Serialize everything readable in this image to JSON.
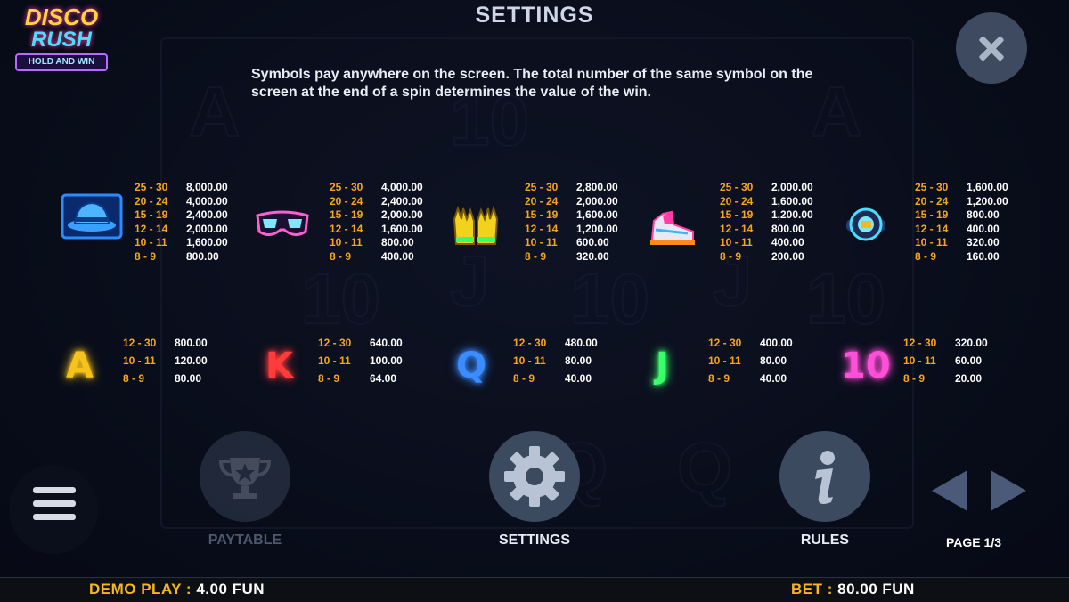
{
  "logo": {
    "line1": "DISCO",
    "line2": "RUSH",
    "badge": "HOLD AND WIN"
  },
  "header": {
    "title": "SETTINGS"
  },
  "description": "Symbols pay anywhere on the screen. The total number of the same symbol on the screen at the end of a spin determines the value of the win.",
  "high_symbols": [
    {
      "icon": "hat-icon",
      "pays": [
        [
          "25 - 30",
          "8,000.00"
        ],
        [
          "20 - 24",
          "4,000.00"
        ],
        [
          "15 - 19",
          "2,400.00"
        ],
        [
          "12 - 14",
          "2,000.00"
        ],
        [
          "10 - 11",
          "1,600.00"
        ],
        [
          "8 - 9",
          "800.00"
        ]
      ]
    },
    {
      "icon": "sunglasses-icon",
      "pays": [
        [
          "25 - 30",
          "4,000.00"
        ],
        [
          "20 - 24",
          "2,400.00"
        ],
        [
          "15 - 19",
          "2,000.00"
        ],
        [
          "12 - 14",
          "1,600.00"
        ],
        [
          "10 - 11",
          "800.00"
        ],
        [
          "8 - 9",
          "400.00"
        ]
      ]
    },
    {
      "icon": "gloves-icon",
      "pays": [
        [
          "25 - 30",
          "2,800.00"
        ],
        [
          "20 - 24",
          "2,000.00"
        ],
        [
          "15 - 19",
          "1,600.00"
        ],
        [
          "12 - 14",
          "1,200.00"
        ],
        [
          "10 - 11",
          "600.00"
        ],
        [
          "8 - 9",
          "320.00"
        ]
      ]
    },
    {
      "icon": "sneaker-icon",
      "pays": [
        [
          "25 - 30",
          "2,000.00"
        ],
        [
          "20 - 24",
          "1,600.00"
        ],
        [
          "15 - 19",
          "1,200.00"
        ],
        [
          "12 - 14",
          "800.00"
        ],
        [
          "10 - 11",
          "400.00"
        ],
        [
          "8 - 9",
          "200.00"
        ]
      ]
    },
    {
      "icon": "watch-icon",
      "pays": [
        [
          "25 - 30",
          "1,600.00"
        ],
        [
          "20 - 24",
          "1,200.00"
        ],
        [
          "15 - 19",
          "800.00"
        ],
        [
          "12 - 14",
          "400.00"
        ],
        [
          "10 - 11",
          "320.00"
        ],
        [
          "8 - 9",
          "160.00"
        ]
      ]
    }
  ],
  "low_symbols": [
    {
      "letter": "A",
      "color": "#f6c21c",
      "pays": [
        [
          "12 - 30",
          "800.00"
        ],
        [
          "10 - 11",
          "120.00"
        ],
        [
          "8 - 9",
          "80.00"
        ]
      ]
    },
    {
      "letter": "K",
      "color": "#ff3b3b",
      "pays": [
        [
          "12 - 30",
          "640.00"
        ],
        [
          "10 - 11",
          "100.00"
        ],
        [
          "8 - 9",
          "64.00"
        ]
      ]
    },
    {
      "letter": "Q",
      "color": "#3b8cff",
      "pays": [
        [
          "12 - 30",
          "480.00"
        ],
        [
          "10 - 11",
          "80.00"
        ],
        [
          "8 - 9",
          "40.00"
        ]
      ]
    },
    {
      "letter": "J",
      "color": "#3bff6a",
      "pays": [
        [
          "12 - 30",
          "400.00"
        ],
        [
          "10 - 11",
          "80.00"
        ],
        [
          "8 - 9",
          "40.00"
        ]
      ]
    },
    {
      "letter": "10",
      "color": "#ff4fd8",
      "pays": [
        [
          "12 - 30",
          "320.00"
        ],
        [
          "10 - 11",
          "60.00"
        ],
        [
          "8 - 9",
          "20.00"
        ]
      ]
    }
  ],
  "nav": {
    "paytable": "PAYTABLE",
    "settings": "SETTINGS",
    "rules": "RULES",
    "page": "PAGE 1/3"
  },
  "footer": {
    "demo_label": "DEMO PLAY :",
    "demo_value": "4.00 FUN",
    "bet_label": "BET :",
    "bet_value": "80.00 FUN"
  }
}
